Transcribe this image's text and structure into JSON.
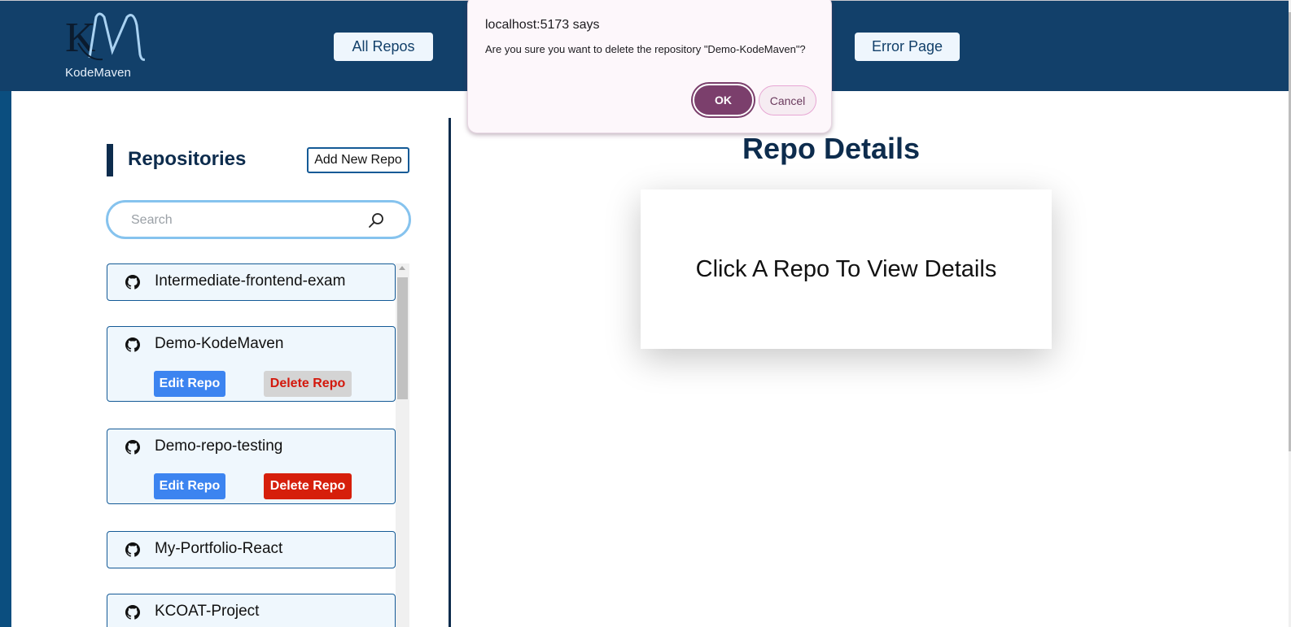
{
  "header": {
    "logo_monogram": "KM",
    "logo_text": "KodeMaven",
    "nav": [
      {
        "label": "All Repos"
      },
      {
        "label": "Error Page"
      }
    ],
    "background_color": "#12406a"
  },
  "repos": {
    "title": "Repositories",
    "add_button": "Add New Repo",
    "search": {
      "placeholder": "Search",
      "value": ""
    },
    "items": [
      {
        "name": "Intermediate-frontend-exam",
        "expanded": false
      },
      {
        "name": "Demo-KodeMaven",
        "expanded": true,
        "edit_label": "Edit Repo",
        "delete_label": "Delete Repo",
        "delete_state": "pending"
      },
      {
        "name": "Demo-repo-testing",
        "expanded": true,
        "edit_label": "Edit Repo",
        "delete_label": "Delete Repo",
        "delete_state": "active"
      },
      {
        "name": "My-Portfolio-React",
        "expanded": false
      },
      {
        "name": "KCOAT-Project",
        "expanded": false
      }
    ]
  },
  "details": {
    "title": "Repo Details",
    "message": "Click A Repo To View Details"
  },
  "dialog": {
    "title": "localhost:5173 says",
    "message": "Are you sure you want to delete the repository \"Demo-KodeMaven\"?",
    "ok_label": "OK",
    "cancel_label": "Cancel"
  },
  "colors": {
    "primary": "#12406a",
    "accent_dark": "#0d2c4d",
    "edit": "#3c84f0",
    "delete": "#d61f0b",
    "dialog_ok": "#7b3f6c"
  }
}
